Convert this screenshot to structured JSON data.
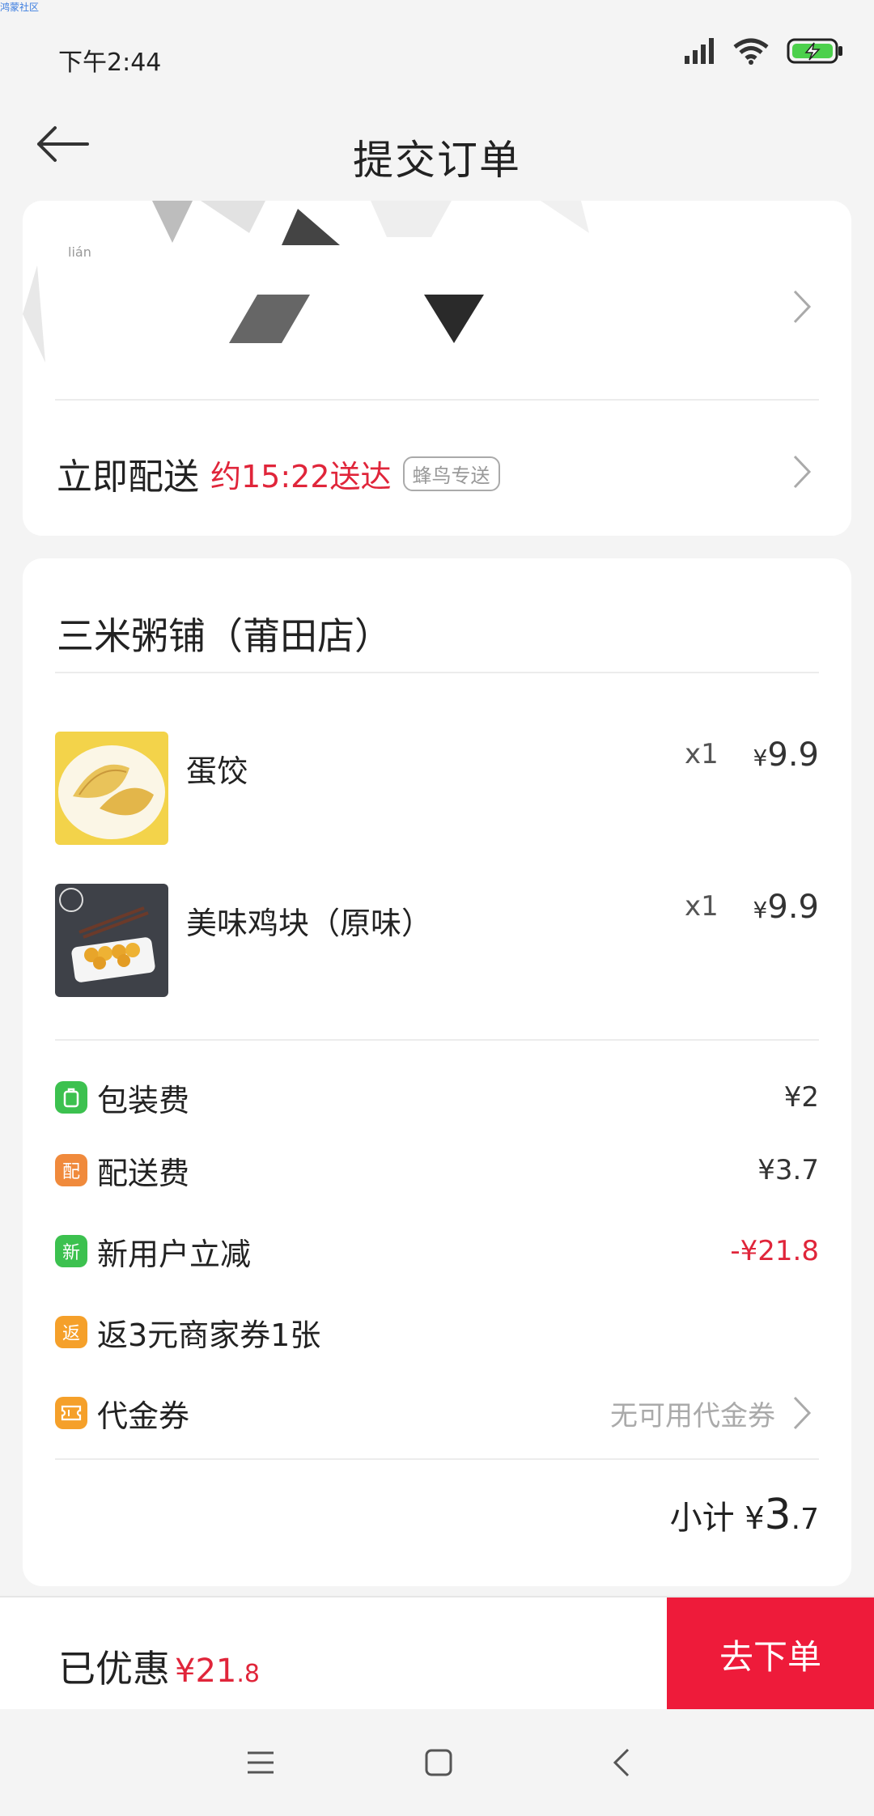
{
  "watermark": "鸿蒙社区",
  "status_bar": {
    "time": "下午2:44"
  },
  "header": {
    "title": "提交订单"
  },
  "address": {
    "text": "lián"
  },
  "delivery": {
    "label": "立即配送",
    "time": "约15:22送达",
    "badge": "蜂鸟专送"
  },
  "shop": {
    "name": "三米粥铺（莆田店）"
  },
  "items": [
    {
      "name": "蛋饺",
      "qty": "x1",
      "currency": "¥",
      "price": "9.9"
    },
    {
      "name": "美味鸡块（原味）",
      "qty": "x1",
      "currency": "¥",
      "price": "9.9"
    }
  ],
  "fees": [
    {
      "icon": "bag-icon",
      "label": "包装费",
      "value": "¥2",
      "color": "#3cc14f"
    },
    {
      "icon": "配",
      "label": "配送费",
      "value": "¥3.7",
      "color": "#f08a3c"
    },
    {
      "icon": "新",
      "label": "新用户立减",
      "value": "-¥21.8",
      "color": "#3cc14f"
    },
    {
      "icon": "返",
      "label": "返3元商家券1张",
      "value": "",
      "color": "#f5a02a"
    },
    {
      "icon": "ticket-icon",
      "label": "代金券",
      "value": "无可用代金券",
      "color": "#f5a02a"
    }
  ],
  "subtotal": {
    "label": "小计",
    "currency": "¥",
    "int": "3",
    "dec": ".7"
  },
  "bottom": {
    "saved_label": "已优惠",
    "saved_currency": "¥",
    "saved_int": "21",
    "saved_dec": ".8",
    "submit_label": "去下单"
  },
  "colors": {
    "accent": "#ee1b3a",
    "price_red": "#e0253a"
  }
}
